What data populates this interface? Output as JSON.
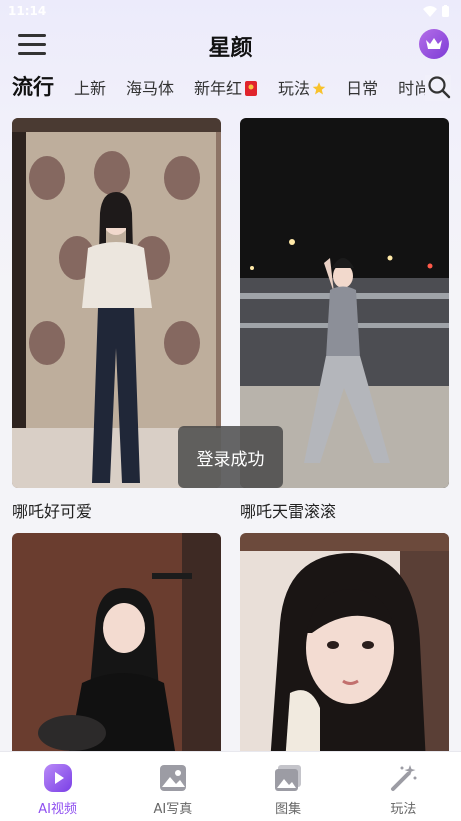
{
  "status_bar": {
    "time": "11:14"
  },
  "header": {
    "title": "星颜"
  },
  "tabs": [
    {
      "label": "流行",
      "active": true
    },
    {
      "label": "上新"
    },
    {
      "label": "海马体"
    },
    {
      "label": "新年红",
      "icon": "red-envelope-icon"
    },
    {
      "label": "玩法",
      "icon": "star-icon"
    },
    {
      "label": "日常"
    },
    {
      "label": "时尚"
    }
  ],
  "cards": [
    {
      "title": "哪吒好可爱"
    },
    {
      "title": "哪吒天雷滚滚"
    },
    {
      "title": ""
    },
    {
      "title": ""
    }
  ],
  "toast": {
    "text": "登录成功"
  },
  "bottom_nav": [
    {
      "label": "AI视频",
      "icon": "play-icon",
      "active": true
    },
    {
      "label": "AI写真",
      "icon": "photo-icon"
    },
    {
      "label": "图集",
      "icon": "gallery-icon"
    },
    {
      "label": "玩法",
      "icon": "magic-wand-icon"
    }
  ],
  "colors": {
    "accent": "#8f4ff0",
    "toast_bg": "#464646",
    "vip": "#9b52e0"
  }
}
